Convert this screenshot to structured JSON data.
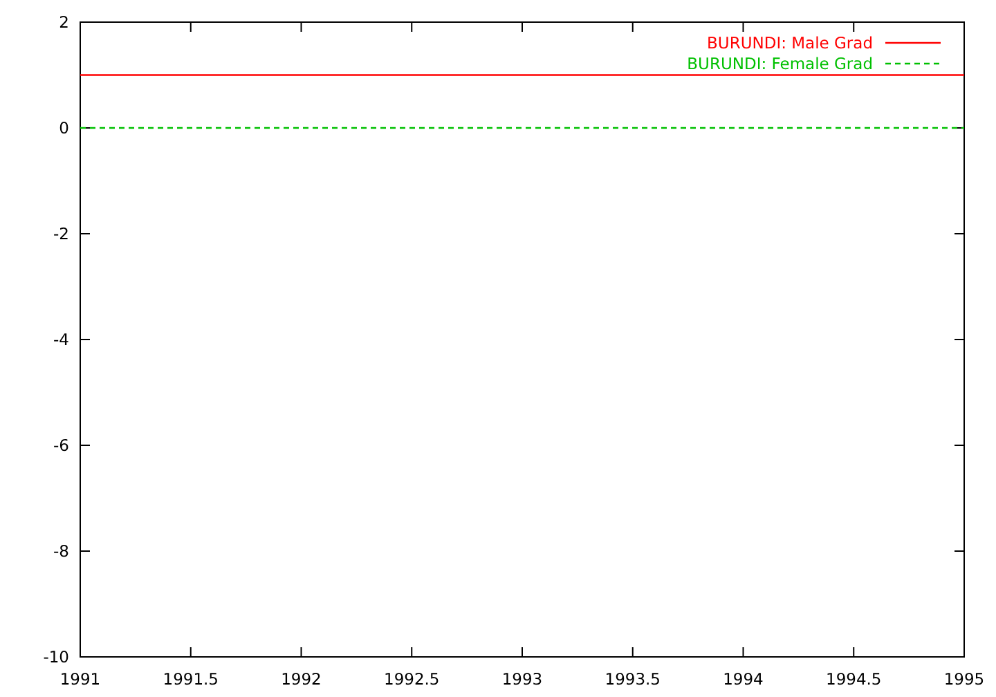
{
  "chart_data": {
    "type": "line",
    "x": [
      1991,
      1995
    ],
    "series": [
      {
        "name": "BURUNDI: Male Grad",
        "color": "#ff0000",
        "line_style": "solid",
        "values": [
          1,
          1
        ]
      },
      {
        "name": "BURUNDI: Female Grad",
        "color": "#00c000",
        "line_style": "dashed",
        "values": [
          0,
          0
        ]
      }
    ],
    "legend": true,
    "xlim": [
      1991,
      1995
    ],
    "ylim": [
      -10,
      2
    ],
    "xticks": [
      {
        "value": 1991,
        "label": "1991"
      },
      {
        "value": 1991.5,
        "label": "1991.5"
      },
      {
        "value": 1992,
        "label": "1992"
      },
      {
        "value": 1992.5,
        "label": "1992.5"
      },
      {
        "value": 1993,
        "label": "1993"
      },
      {
        "value": 1993.5,
        "label": "1993.5"
      },
      {
        "value": 1994,
        "label": "1994"
      },
      {
        "value": 1994.5,
        "label": "1994.5"
      },
      {
        "value": 1995,
        "label": "1995"
      }
    ],
    "yticks": [
      {
        "value": 2,
        "label": "2"
      },
      {
        "value": 0,
        "label": "0"
      },
      {
        "value": -2,
        "label": "-2"
      },
      {
        "value": -4,
        "label": "-4"
      },
      {
        "value": -6,
        "label": "-6"
      },
      {
        "value": -8,
        "label": "-8"
      },
      {
        "value": -10,
        "label": "-10"
      }
    ]
  }
}
